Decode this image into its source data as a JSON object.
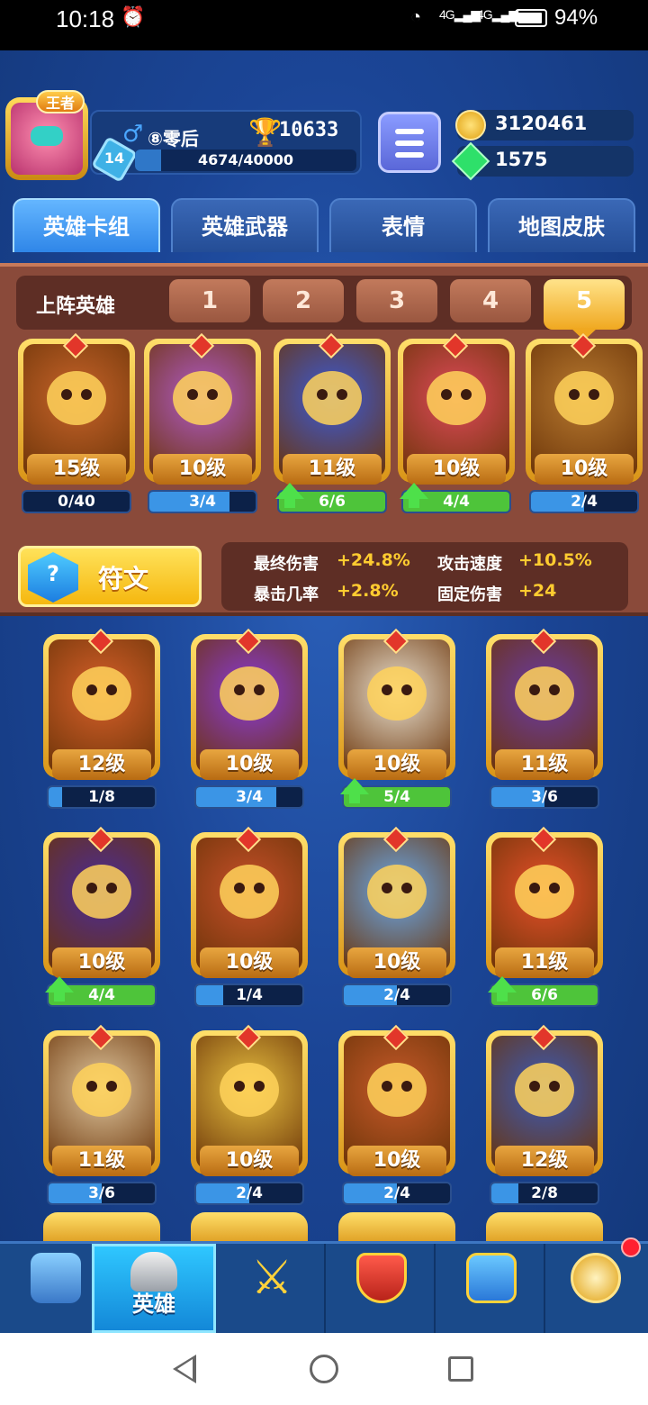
{
  "status_bar": {
    "time": "10:18",
    "battery": "94%",
    "network1": "4G",
    "network2": "4G"
  },
  "player": {
    "name": "⑧零后",
    "rank_badge": "王者",
    "trophies": "10633",
    "level": "14",
    "xp": "4674/40000",
    "xp_fraction": 0.117
  },
  "resources": {
    "coins": "3120461",
    "gems": "1575"
  },
  "tabs": [
    "英雄卡组",
    "英雄武器",
    "表情",
    "地图皮肤"
  ],
  "squad": {
    "label": "上阵英雄",
    "deck_tabs": [
      "1",
      "2",
      "3",
      "4",
      "5"
    ],
    "active_deck": "5",
    "heroes": [
      {
        "level": "15级",
        "progress": "0/40",
        "fraction": 0.0,
        "upgrade": false,
        "color": "#c8642a"
      },
      {
        "level": "10级",
        "progress": "3/4",
        "fraction": 0.75,
        "upgrade": false,
        "color": "#b05ac8"
      },
      {
        "level": "11级",
        "progress": "6/6",
        "fraction": 1.0,
        "upgrade": true,
        "color": "#3a5ad8"
      },
      {
        "level": "10级",
        "progress": "4/4",
        "fraction": 1.0,
        "upgrade": true,
        "color": "#e04a5a"
      },
      {
        "level": "10级",
        "progress": "2/4",
        "fraction": 0.5,
        "upgrade": false,
        "color": "#b87a30"
      }
    ]
  },
  "rune": {
    "label": "符文"
  },
  "stats": [
    {
      "name": "最终伤害",
      "value": "+24.8%"
    },
    {
      "name": "攻击速度",
      "value": "+10.5%"
    },
    {
      "name": "暴击几率",
      "value": "+2.8%"
    },
    {
      "name": "固定伤害",
      "value": "+24"
    }
  ],
  "collection": [
    {
      "level": "12级",
      "progress": "1/8",
      "fraction": 0.125,
      "upgrade": false,
      "color": "#d8602a"
    },
    {
      "level": "10级",
      "progress": "3/4",
      "fraction": 0.75,
      "upgrade": false,
      "color": "#8a3ad8"
    },
    {
      "level": "10级",
      "progress": "5/4",
      "fraction": 1.0,
      "upgrade": true,
      "color": "#e8e0d0"
    },
    {
      "level": "11级",
      "progress": "3/6",
      "fraction": 0.5,
      "upgrade": false,
      "color": "#6a3aa8"
    },
    {
      "level": "10级",
      "progress": "4/4",
      "fraction": 1.0,
      "upgrade": true,
      "color": "#4a2a9a"
    },
    {
      "level": "10级",
      "progress": "1/4",
      "fraction": 0.25,
      "upgrade": false,
      "color": "#c8502a"
    },
    {
      "level": "10级",
      "progress": "2/4",
      "fraction": 0.5,
      "upgrade": false,
      "color": "#6aa8e8"
    },
    {
      "level": "11级",
      "progress": "6/6",
      "fraction": 1.0,
      "upgrade": true,
      "color": "#e8502a"
    },
    {
      "level": "11级",
      "progress": "3/6",
      "fraction": 0.5,
      "upgrade": false,
      "color": "#e0c8a0"
    },
    {
      "level": "10级",
      "progress": "2/4",
      "fraction": 0.5,
      "upgrade": false,
      "color": "#e8c040"
    },
    {
      "level": "10级",
      "progress": "2/4",
      "fraction": 0.5,
      "upgrade": false,
      "color": "#c85a2a"
    },
    {
      "level": "12级",
      "progress": "2/8",
      "fraction": 0.25,
      "upgrade": false,
      "color": "#3a5ab8"
    }
  ],
  "bottom_nav": [
    {
      "icon": "treasure-chest-icon",
      "label": ""
    },
    {
      "icon": "knight-helmet-icon",
      "label": "英雄"
    },
    {
      "icon": "crossed-swords-icon",
      "label": ""
    },
    {
      "icon": "crown-shield-icon",
      "label": ""
    },
    {
      "icon": "team-banner-icon",
      "label": ""
    },
    {
      "icon": "compass-icon",
      "label": ""
    }
  ]
}
